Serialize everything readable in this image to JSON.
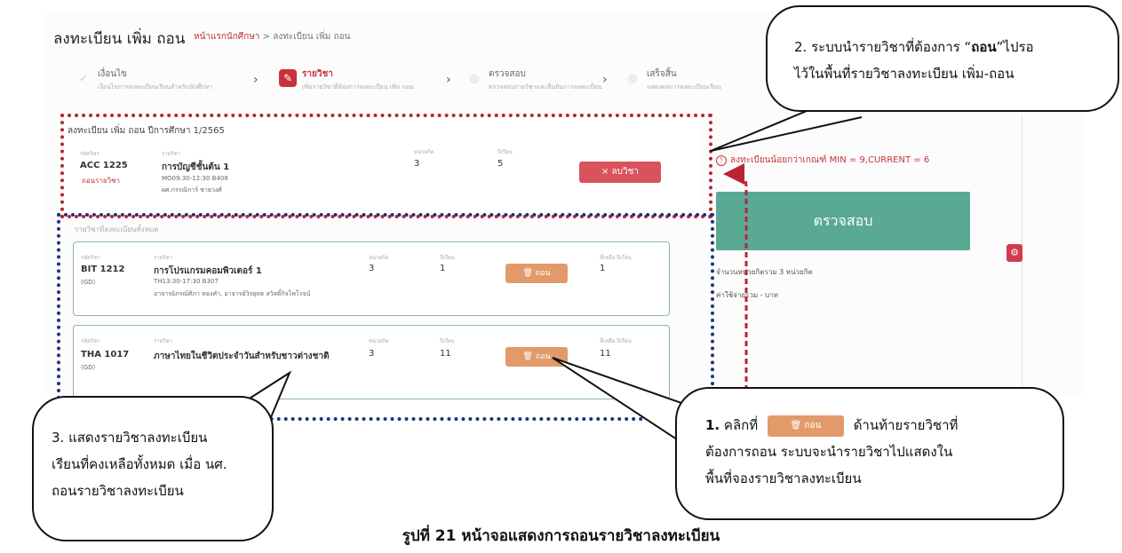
{
  "header": {
    "title": "ลงทะเบียน เพิ่ม ถอน",
    "breadcrumb_home": "หน้าแรกนักศึกษา",
    "breadcrumb_sep": ">",
    "breadcrumb_current": "ลงทะเบียน เพิ่ม ถอน"
  },
  "steps": [
    {
      "title": "เงื่อนไข",
      "sub": "เงื่อนไขการลงทะเบียนเรียนสำหรับนักศึกษา"
    },
    {
      "title": "รายวิชา",
      "sub": "เพิ่มรายวิชาที่ต้องการลงทะเบียน เพิ่ม ถอน"
    },
    {
      "title": "ตรวจสอบ",
      "sub": "ตรวจสอบรายวิชาและยืนยันการลงทะเบียน"
    },
    {
      "title": "เสร็จสิ้น",
      "sub": "แสดงผลการลงทะเบียนเรียน"
    }
  ],
  "basket": {
    "title": "ลงทะเบียน เพิ่ม ถอน ปีการศึกษา 1/2565",
    "labels": {
      "code": "รหัสวิชา",
      "name": "รายวิชา",
      "credit": "หน่วยกิต",
      "section": "ปีเรียน"
    },
    "course": {
      "code": "ACC 1225",
      "status": "ถอนรายวิชา",
      "name": "การบัญชีชั้นต้น 1",
      "time": "MO09:30-12:30 B408",
      "teacher": "ผศ.กรรณิการ์ ชายวงศ์",
      "credit": "3",
      "section": "5"
    },
    "remove_label": "× ลบวิชา"
  },
  "course_list": {
    "title": "รายวิชาที่ลงทะเบียนทั้งหมด",
    "labels": {
      "code": "รหัสวิชา",
      "name": "รายวิชา",
      "credit": "หน่วยกิต",
      "section": "ปีเรียน",
      "remain": "ที่เหลือ ปีเรียน"
    },
    "items": [
      {
        "code": "BIT 1212",
        "group": "(GD)",
        "name": "การโปรแกรมคอมพิวเตอร์ 1",
        "time": "TH13:30-17:30 B307",
        "teacher": "อาจารย์ภรณ์ศิภา ทองคำ, อาจารย์วิรยุทธ สวัสดิ์กิจไพโรจน์",
        "credit": "3",
        "section": "1",
        "remain": "1",
        "drop_label": "ถอน"
      },
      {
        "code": "THA 1017",
        "group": "(GD)",
        "name": "ภาษาไทยในชีวิตประจำวันสำหรับชาวต่างชาติ",
        "credit": "3",
        "section": "11",
        "remain": "11",
        "drop_label": "ถอน"
      }
    ]
  },
  "side": {
    "warning": "ลงทะเบียนน้อยกว่าเกณฑ์ MIN = 9,CURRENT = 6",
    "check_button": "ตรวจสอบ",
    "total_credits": "จำนวนหน่วยกิตรวม 3 หน่วยกิต",
    "fee": "ค่าใช้จ่ายรวม - บาท"
  },
  "callouts": {
    "c1_num": "1.",
    "c1_prefix": "คลิกที่",
    "c1_button": "ถอน",
    "c1_suffix": "ด้านท้ายรายวิชาที่",
    "c1_line2": "ต้องการถอน ระบบจะนำรายวิชาไปแสดงใน",
    "c1_line3": "พื้นที่จองรายวิชาลงทะเบียน",
    "c2_line1_a": "2. ระบบนำรายวิชาที่ต้องการ “",
    "c2_line1_b": "ถอน",
    "c2_line1_c": "”ไปรอ",
    "c2_line2": "ไว้ในพื้นที่รายวิชาลงทะเบียน เพิ่ม-ถอน",
    "c3_line1": "3. แสดงรายวิชาลงทะเบียน",
    "c3_line2": "เรียนที่คงเหลือทั้งหมด เมื่อ นศ.",
    "c3_line3": "ถอนรายวิชาลงทะเบียน"
  },
  "caption": "รูปที่ 21 หน้าจอแสดงการถอนรายวิชาลงทะเบียน"
}
